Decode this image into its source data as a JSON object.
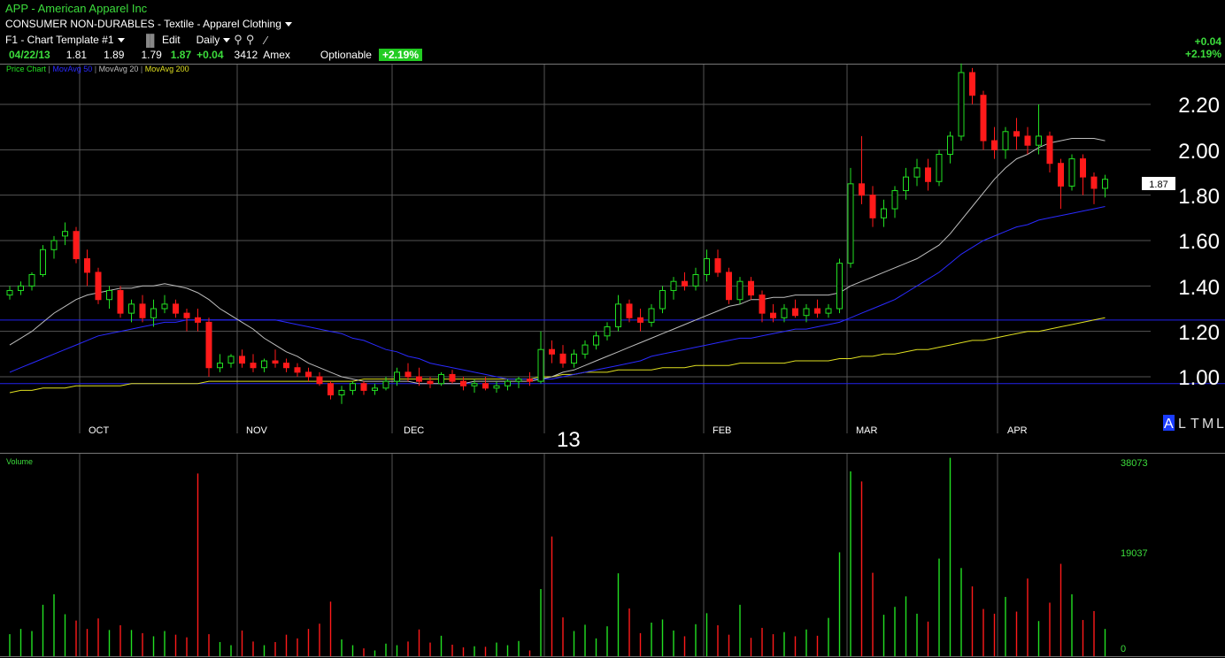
{
  "header": {
    "symbol_line": "APP  -  American Apparel Inc",
    "sector_line": "CONSUMER NON-DURABLES - Textile - Apparel Clothing",
    "template_label": "F1 - Chart Template #1",
    "edit_label": "Edit",
    "period_label": "Daily",
    "quote": {
      "date": "04/22/13",
      "open": "1.81",
      "high": "1.89",
      "low": "1.79",
      "last": "1.87",
      "change": "+0.04",
      "volume": "3412",
      "exchange": "Amex",
      "optionable": "Optionable",
      "pct_badge": "+2.19%"
    },
    "right_change": "+0.04",
    "right_pct": "+2.19%"
  },
  "legend": {
    "price": "Price Chart",
    "ma50": "MovAvg 50",
    "ma20": "MovAvg 20",
    "ma200": "MovAvg 200"
  },
  "price_axis": {
    "ticks": [
      "2.20",
      "2.00",
      "1.80",
      "1.60",
      "1.40",
      "1.20",
      "1.00"
    ],
    "last_label": "1.87"
  },
  "time_axis": {
    "months": [
      "OCT",
      "NOV",
      "DEC",
      "FEB",
      "MAR",
      "APR"
    ],
    "year": "13"
  },
  "scale_buttons": [
    "A",
    "L",
    "T",
    "M",
    "L"
  ],
  "volume_panel": {
    "title": "Volume",
    "ticks": [
      "38073",
      "19037",
      "0"
    ]
  },
  "colors": {
    "up": "#22e022",
    "down": "#ff1a1a",
    "ma20": "#bdbdbd",
    "ma50": "#2a2aff",
    "ma200": "#e0e020",
    "grid": "#555555",
    "accent_green": "#3cdc3c"
  },
  "chart_data": {
    "type": "candlestick",
    "ylim": [
      0.9,
      2.4
    ],
    "volume_ylim": [
      0,
      38073
    ],
    "candles": [
      [
        1.36,
        1.4,
        1.34,
        1.38
      ],
      [
        1.38,
        1.42,
        1.36,
        1.4
      ],
      [
        1.4,
        1.46,
        1.38,
        1.45
      ],
      [
        1.45,
        1.58,
        1.44,
        1.56
      ],
      [
        1.56,
        1.62,
        1.52,
        1.6
      ],
      [
        1.62,
        1.68,
        1.58,
        1.64
      ],
      [
        1.64,
        1.66,
        1.5,
        1.52
      ],
      [
        1.52,
        1.56,
        1.4,
        1.46
      ],
      [
        1.46,
        1.48,
        1.32,
        1.34
      ],
      [
        1.34,
        1.4,
        1.3,
        1.38
      ],
      [
        1.38,
        1.4,
        1.26,
        1.28
      ],
      [
        1.28,
        1.34,
        1.24,
        1.32
      ],
      [
        1.32,
        1.36,
        1.24,
        1.26
      ],
      [
        1.26,
        1.34,
        1.22,
        1.3
      ],
      [
        1.3,
        1.36,
        1.28,
        1.32
      ],
      [
        1.32,
        1.34,
        1.26,
        1.28
      ],
      [
        1.28,
        1.3,
        1.2,
        1.26
      ],
      [
        1.26,
        1.3,
        1.2,
        1.24
      ],
      [
        1.24,
        1.26,
        1.0,
        1.04
      ],
      [
        1.04,
        1.1,
        1.02,
        1.06
      ],
      [
        1.06,
        1.1,
        1.04,
        1.09
      ],
      [
        1.09,
        1.12,
        1.04,
        1.06
      ],
      [
        1.06,
        1.1,
        1.02,
        1.04
      ],
      [
        1.04,
        1.08,
        1.02,
        1.07
      ],
      [
        1.07,
        1.12,
        1.04,
        1.06
      ],
      [
        1.06,
        1.08,
        1.02,
        1.04
      ],
      [
        1.04,
        1.06,
        1.0,
        1.02
      ],
      [
        1.02,
        1.04,
        0.98,
        1.0
      ],
      [
        1.0,
        1.02,
        0.96,
        0.97
      ],
      [
        0.97,
        0.98,
        0.9,
        0.92
      ],
      [
        0.92,
        0.96,
        0.88,
        0.94
      ],
      [
        0.94,
        0.98,
        0.92,
        0.97
      ],
      [
        0.97,
        0.98,
        0.92,
        0.94
      ],
      [
        0.94,
        0.97,
        0.92,
        0.95
      ],
      [
        0.95,
        1.0,
        0.94,
        0.98
      ],
      [
        0.98,
        1.04,
        0.96,
        1.02
      ],
      [
        1.02,
        1.06,
        0.98,
        1.0
      ],
      [
        1.0,
        1.04,
        0.96,
        0.98
      ],
      [
        0.98,
        1.0,
        0.95,
        0.97
      ],
      [
        0.97,
        1.02,
        0.96,
        1.01
      ],
      [
        1.01,
        1.03,
        0.97,
        0.98
      ],
      [
        0.98,
        1.0,
        0.94,
        0.96
      ],
      [
        0.96,
        0.99,
        0.93,
        0.97
      ],
      [
        0.97,
        1.0,
        0.94,
        0.95
      ],
      [
        0.95,
        0.98,
        0.93,
        0.96
      ],
      [
        0.96,
        0.99,
        0.94,
        0.98
      ],
      [
        0.98,
        1.0,
        0.95,
        0.99
      ],
      [
        0.99,
        1.02,
        0.96,
        0.98
      ],
      [
        0.98,
        1.2,
        0.97,
        1.12
      ],
      [
        1.12,
        1.16,
        1.06,
        1.1
      ],
      [
        1.1,
        1.14,
        1.04,
        1.06
      ],
      [
        1.06,
        1.12,
        1.04,
        1.1
      ],
      [
        1.1,
        1.16,
        1.08,
        1.14
      ],
      [
        1.14,
        1.2,
        1.12,
        1.18
      ],
      [
        1.18,
        1.24,
        1.16,
        1.22
      ],
      [
        1.22,
        1.36,
        1.2,
        1.32
      ],
      [
        1.32,
        1.34,
        1.24,
        1.26
      ],
      [
        1.26,
        1.3,
        1.2,
        1.24
      ],
      [
        1.24,
        1.32,
        1.22,
        1.3
      ],
      [
        1.3,
        1.4,
        1.28,
        1.38
      ],
      [
        1.38,
        1.44,
        1.34,
        1.42
      ],
      [
        1.42,
        1.46,
        1.38,
        1.4
      ],
      [
        1.4,
        1.48,
        1.38,
        1.45
      ],
      [
        1.45,
        1.56,
        1.42,
        1.52
      ],
      [
        1.52,
        1.56,
        1.44,
        1.46
      ],
      [
        1.46,
        1.48,
        1.32,
        1.34
      ],
      [
        1.34,
        1.44,
        1.32,
        1.42
      ],
      [
        1.42,
        1.44,
        1.34,
        1.36
      ],
      [
        1.36,
        1.38,
        1.24,
        1.28
      ],
      [
        1.28,
        1.32,
        1.24,
        1.26
      ],
      [
        1.26,
        1.32,
        1.24,
        1.3
      ],
      [
        1.3,
        1.34,
        1.26,
        1.27
      ],
      [
        1.27,
        1.32,
        1.24,
        1.3
      ],
      [
        1.3,
        1.34,
        1.26,
        1.28
      ],
      [
        1.28,
        1.32,
        1.26,
        1.3
      ],
      [
        1.3,
        1.52,
        1.28,
        1.5
      ],
      [
        1.5,
        1.92,
        1.48,
        1.85
      ],
      [
        1.85,
        2.06,
        1.76,
        1.8
      ],
      [
        1.8,
        1.84,
        1.66,
        1.7
      ],
      [
        1.7,
        1.78,
        1.66,
        1.74
      ],
      [
        1.74,
        1.84,
        1.7,
        1.82
      ],
      [
        1.82,
        1.92,
        1.78,
        1.88
      ],
      [
        1.88,
        1.96,
        1.84,
        1.92
      ],
      [
        1.92,
        1.96,
        1.82,
        1.86
      ],
      [
        1.86,
        2.0,
        1.84,
        1.98
      ],
      [
        1.98,
        2.08,
        1.94,
        2.06
      ],
      [
        2.06,
        2.38,
        2.04,
        2.34
      ],
      [
        2.34,
        2.36,
        2.2,
        2.24
      ],
      [
        2.24,
        2.26,
        2.0,
        2.04
      ],
      [
        2.04,
        2.1,
        1.96,
        2.0
      ],
      [
        2.0,
        2.1,
        1.96,
        2.08
      ],
      [
        2.08,
        2.14,
        2.0,
        2.06
      ],
      [
        2.06,
        2.1,
        1.98,
        2.02
      ],
      [
        2.02,
        2.2,
        1.98,
        2.06
      ],
      [
        2.06,
        2.08,
        1.9,
        1.94
      ],
      [
        1.94,
        1.96,
        1.74,
        1.84
      ],
      [
        1.84,
        1.98,
        1.82,
        1.96
      ],
      [
        1.96,
        1.98,
        1.8,
        1.88
      ],
      [
        1.88,
        1.9,
        1.76,
        1.83
      ],
      [
        1.83,
        1.89,
        1.79,
        1.87
      ]
    ],
    "volume": [
      4200,
      5200,
      4800,
      9800,
      11800,
      8000,
      6800,
      5200,
      7200,
      5000,
      5900,
      5000,
      4400,
      3800,
      4800,
      4100,
      3600,
      34800,
      4200,
      2700,
      2100,
      4900,
      2800,
      2100,
      2700,
      4100,
      3400,
      5200,
      6200,
      10400,
      3200,
      2100,
      1500,
      1100,
      2400,
      2100,
      2800,
      5100,
      2600,
      3900,
      2200,
      1700,
      1900,
      1800,
      2600,
      2100,
      2900,
      1100,
      12800,
      22800,
      7400,
      4800,
      6000,
      3400,
      5700,
      15800,
      9100,
      4400,
      6400,
      7000,
      4900,
      3800,
      6100,
      8200,
      5900,
      4100,
      9800,
      3500,
      5400,
      4200,
      4600,
      3800,
      5100,
      3900,
      7300,
      19800,
      35200,
      33300,
      15900,
      7900,
      9400,
      11400,
      8100,
      6600,
      18600,
      37800,
      16800,
      13300,
      9000,
      8100,
      11300,
      8500,
      14800,
      6700,
      10200,
      17600,
      11800,
      6900,
      8600,
      5200
    ],
    "ma20": [
      1.14,
      1.17,
      1.2,
      1.24,
      1.28,
      1.31,
      1.34,
      1.36,
      1.37,
      1.38,
      1.39,
      1.39,
      1.4,
      1.4,
      1.41,
      1.4,
      1.39,
      1.37,
      1.34,
      1.3,
      1.27,
      1.24,
      1.21,
      1.17,
      1.14,
      1.11,
      1.09,
      1.06,
      1.04,
      1.02,
      1.0,
      0.99,
      0.98,
      0.98,
      0.98,
      0.98,
      0.98,
      0.97,
      0.97,
      0.97,
      0.97,
      0.97,
      0.98,
      0.98,
      0.98,
      0.98,
      0.98,
      0.98,
      0.99,
      1.0,
      1.02,
      1.03,
      1.05,
      1.07,
      1.09,
      1.11,
      1.13,
      1.15,
      1.17,
      1.19,
      1.21,
      1.23,
      1.25,
      1.27,
      1.29,
      1.31,
      1.32,
      1.34,
      1.34,
      1.35,
      1.35,
      1.36,
      1.36,
      1.36,
      1.36,
      1.37,
      1.4,
      1.42,
      1.44,
      1.46,
      1.48,
      1.5,
      1.52,
      1.55,
      1.58,
      1.63,
      1.69,
      1.75,
      1.81,
      1.87,
      1.92,
      1.96,
      1.98,
      2.01,
      2.03,
      2.04,
      2.05,
      2.05,
      2.05,
      2.04
    ],
    "ma50": [
      1.02,
      1.04,
      1.06,
      1.08,
      1.1,
      1.12,
      1.14,
      1.16,
      1.18,
      1.19,
      1.2,
      1.21,
      1.22,
      1.23,
      1.24,
      1.24,
      1.25,
      1.25,
      1.25,
      1.25,
      1.25,
      1.25,
      1.25,
      1.25,
      1.25,
      1.24,
      1.23,
      1.22,
      1.21,
      1.2,
      1.19,
      1.17,
      1.16,
      1.14,
      1.12,
      1.11,
      1.09,
      1.08,
      1.06,
      1.05,
      1.04,
      1.03,
      1.02,
      1.01,
      1.0,
      0.99,
      0.99,
      0.99,
      0.99,
      0.99,
      1.0,
      1.01,
      1.02,
      1.03,
      1.04,
      1.05,
      1.06,
      1.07,
      1.09,
      1.1,
      1.11,
      1.12,
      1.13,
      1.14,
      1.15,
      1.16,
      1.17,
      1.17,
      1.18,
      1.19,
      1.2,
      1.21,
      1.21,
      1.22,
      1.23,
      1.24,
      1.26,
      1.28,
      1.3,
      1.32,
      1.34,
      1.37,
      1.4,
      1.43,
      1.46,
      1.5,
      1.54,
      1.57,
      1.6,
      1.62,
      1.64,
      1.66,
      1.67,
      1.69,
      1.7,
      1.71,
      1.72,
      1.73,
      1.74,
      1.75
    ],
    "ma200": [
      0.93,
      0.94,
      0.94,
      0.95,
      0.95,
      0.95,
      0.96,
      0.96,
      0.96,
      0.96,
      0.96,
      0.97,
      0.97,
      0.97,
      0.97,
      0.97,
      0.97,
      0.97,
      0.98,
      0.98,
      0.98,
      0.98,
      0.98,
      0.98,
      0.98,
      0.98,
      0.98,
      0.98,
      0.98,
      0.98,
      0.98,
      0.98,
      0.99,
      0.99,
      0.99,
      0.99,
      0.99,
      0.99,
      0.99,
      0.99,
      0.99,
      0.99,
      0.99,
      0.99,
      0.99,
      0.99,
      0.99,
      0.99,
      1.0,
      1.0,
      1.01,
      1.01,
      1.02,
      1.02,
      1.02,
      1.03,
      1.03,
      1.03,
      1.03,
      1.04,
      1.04,
      1.04,
      1.05,
      1.05,
      1.05,
      1.05,
      1.06,
      1.06,
      1.06,
      1.06,
      1.06,
      1.07,
      1.07,
      1.07,
      1.07,
      1.08,
      1.08,
      1.09,
      1.09,
      1.1,
      1.1,
      1.11,
      1.12,
      1.12,
      1.13,
      1.14,
      1.15,
      1.16,
      1.16,
      1.17,
      1.18,
      1.19,
      1.2,
      1.2,
      1.21,
      1.22,
      1.23,
      1.24,
      1.25,
      1.26
    ],
    "hlines": [
      1.25,
      0.97
    ]
  }
}
